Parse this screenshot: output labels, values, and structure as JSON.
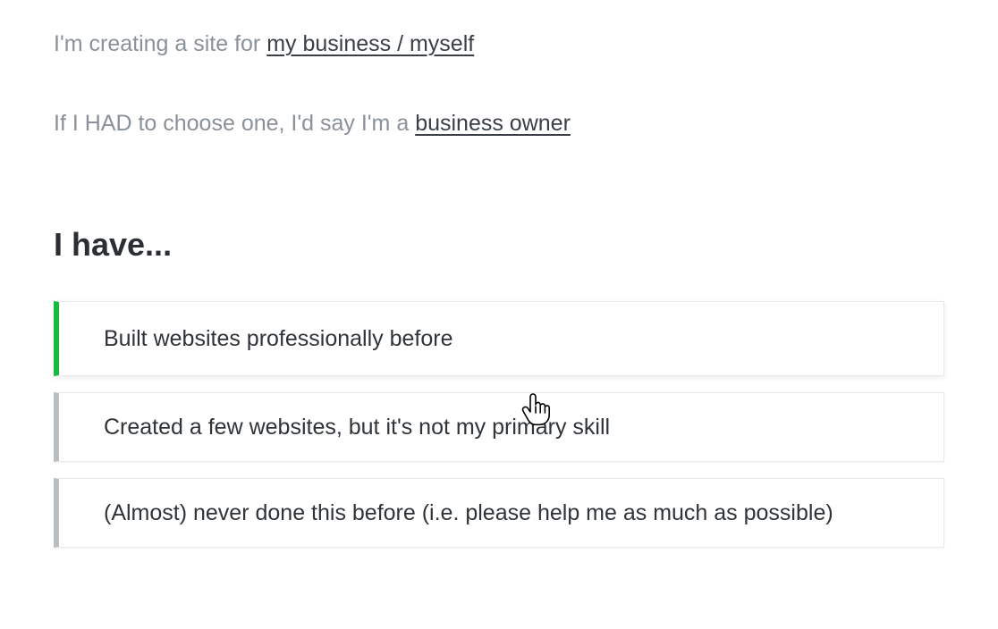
{
  "intro1": {
    "prefix": "I'm creating a site for ",
    "link": "my business / myself"
  },
  "intro2": {
    "prefix": "If I HAD to choose one, I'd say I'm a ",
    "link": "business owner"
  },
  "heading": "I have...",
  "options": [
    {
      "label": "Built websites professionally before"
    },
    {
      "label": "Created a few websites, but it's not my primary skill"
    },
    {
      "label": "(Almost) never done this before (i.e. please help me as much as possible)"
    }
  ]
}
